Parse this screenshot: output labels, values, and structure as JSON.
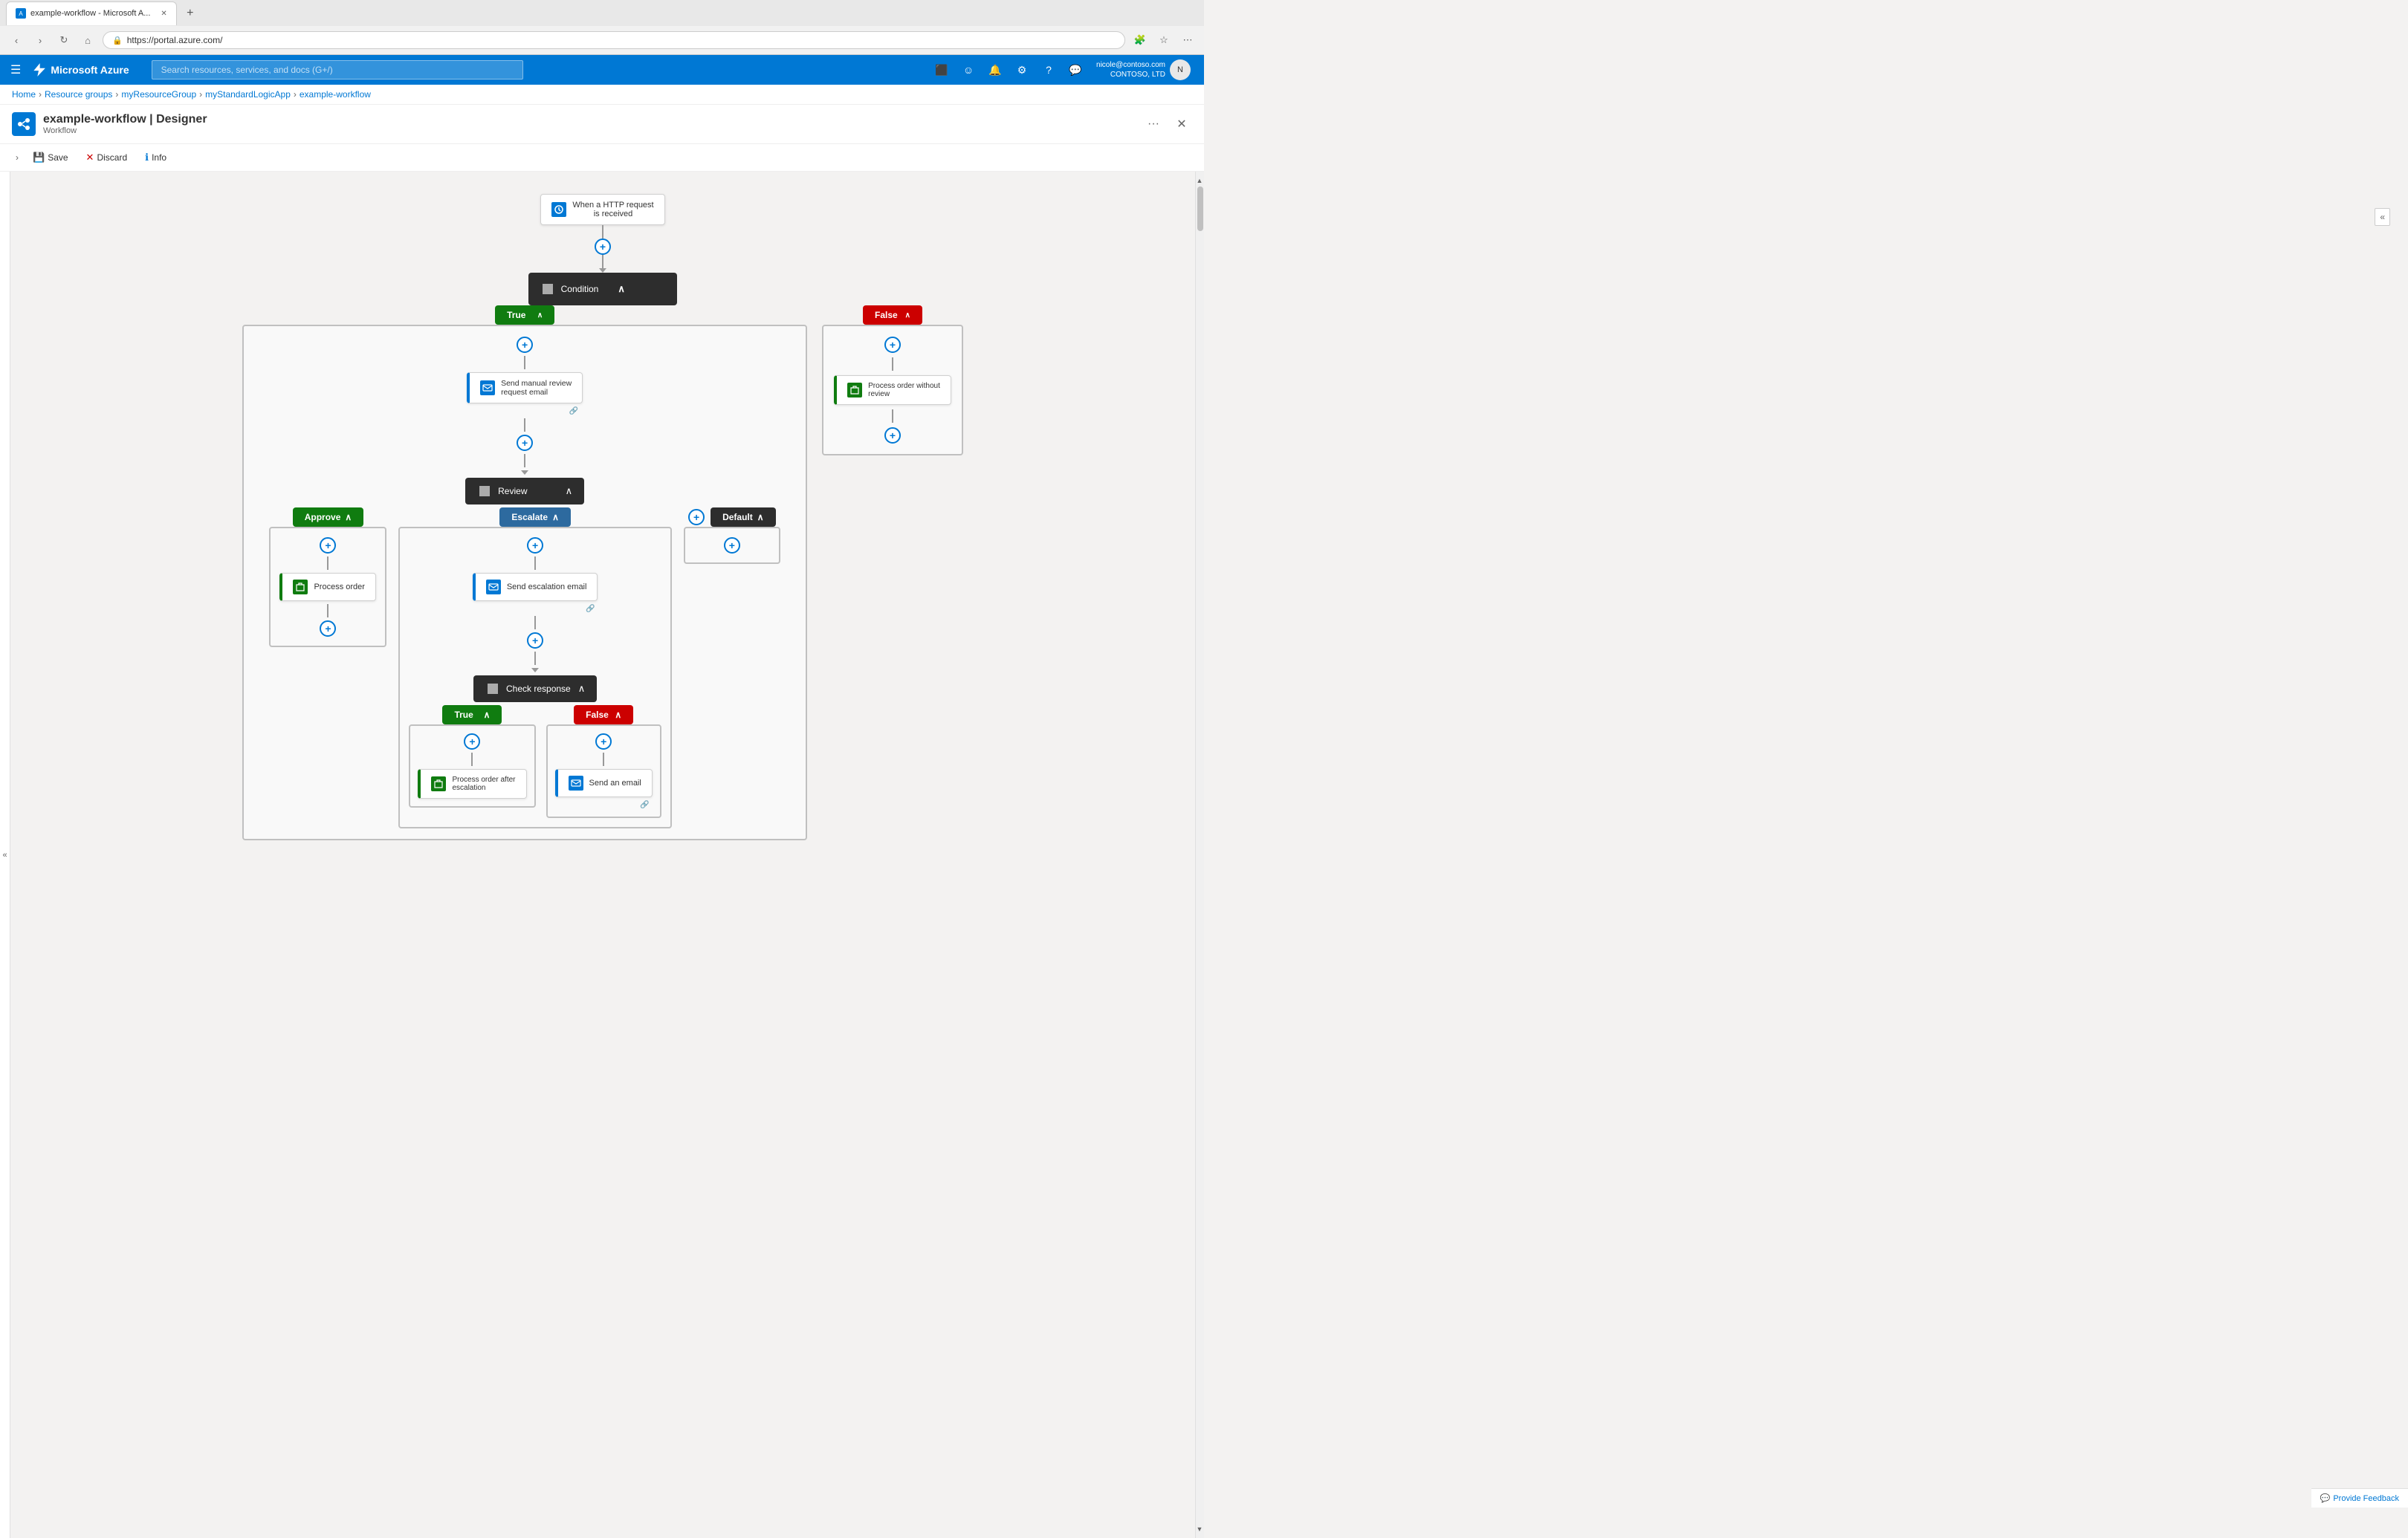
{
  "browser": {
    "tab_title": "example-workflow - Microsoft A...",
    "url": "https://portal.azure.com/",
    "new_tab_label": "+",
    "nav": {
      "back": "‹",
      "forward": "›",
      "refresh": "↻",
      "home": "⌂"
    },
    "actions": [
      "🔍",
      "⭐",
      "👤",
      "⚙",
      "⋯"
    ]
  },
  "topbar": {
    "hamburger": "☰",
    "brand": "Microsoft Azure",
    "search_placeholder": "Search resources, services, and docs (G+/)",
    "icons": [
      "□",
      "🔔",
      "⚙",
      "?",
      "💬"
    ],
    "user_name": "nicole@contoso.com\nCONTOSO, LTD",
    "avatar": "N"
  },
  "breadcrumb": {
    "items": [
      "Home",
      "Resource groups",
      "myResourceGroup",
      "myStandardLogicApp",
      "example-workflow"
    ]
  },
  "page_header": {
    "title": "example-workflow | Designer",
    "subtitle": "Workflow",
    "more_options": "···",
    "close": "✕"
  },
  "toolbar": {
    "save_label": "Save",
    "discard_label": "Discard",
    "info_label": "Info",
    "sidebar_toggle": "›"
  },
  "workflow": {
    "trigger_node": {
      "label": "When a HTTP request\nis received",
      "icon_type": "blue"
    },
    "condition_node": {
      "label": "Condition",
      "icon": "⊞"
    },
    "true_branch": {
      "label": "True",
      "send_email_node": {
        "label": "Send manual review\nrequest email",
        "icon_type": "blue"
      },
      "review_node": {
        "label": "Review",
        "icon": "⊞"
      },
      "approve_branch": {
        "label": "Approve",
        "process_order": {
          "label": "Process order",
          "icon_type": "green"
        }
      },
      "escalate_branch": {
        "label": "Escalate",
        "send_escalation": {
          "label": "Send escalation email",
          "icon_type": "blue"
        },
        "check_response_node": {
          "label": "Check response",
          "icon": "⊞"
        },
        "check_true_branch": {
          "label": "True",
          "process_after_escalation": {
            "label": "Process order after\nescalation",
            "icon_type": "green"
          }
        },
        "check_false_branch": {
          "label": "False",
          "send_email": {
            "label": "Send an email",
            "icon_type": "blue"
          }
        }
      },
      "default_branch": {
        "label": "Default"
      }
    },
    "false_branch": {
      "label": "False",
      "process_without_review": {
        "label": "Process order without\nreview",
        "icon_type": "green"
      }
    }
  },
  "feedback": {
    "label": "Provide Feedback",
    "icon": "💬"
  }
}
